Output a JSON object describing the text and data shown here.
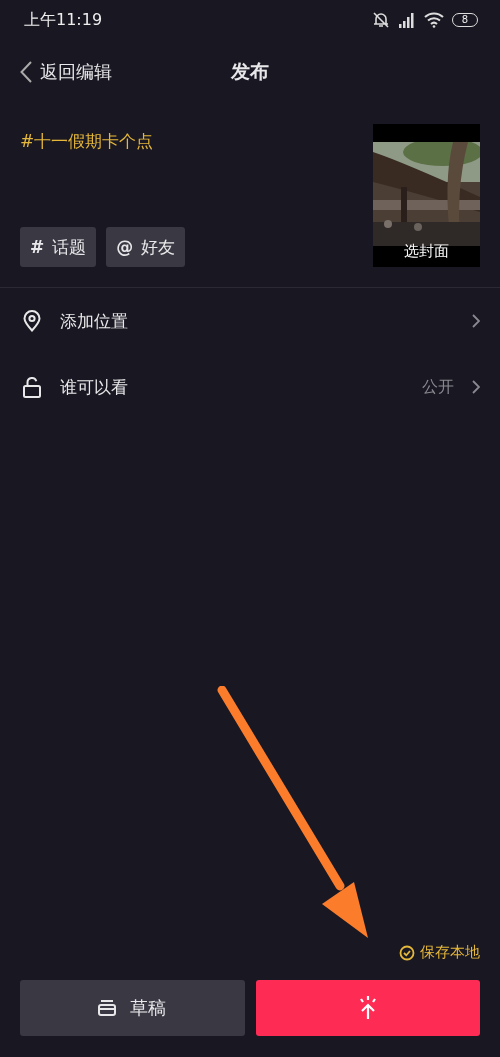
{
  "status_bar": {
    "time": "上午11:19",
    "battery": "8"
  },
  "nav": {
    "back_label": "返回编辑",
    "title": "发布"
  },
  "caption": "#十一假期卡个点",
  "tag_buttons": [
    {
      "label": "话题",
      "icon": "#"
    },
    {
      "label": "好友",
      "icon": "@"
    }
  ],
  "cover": {
    "label": "选封面"
  },
  "settings": [
    {
      "kind": "location",
      "label": "添加位置"
    },
    {
      "kind": "visibility",
      "label": "谁可以看",
      "value": "公开"
    }
  ],
  "save_local": {
    "label": "保存本地",
    "checked": true
  },
  "buttons": [
    {
      "kind": "draft",
      "label": "草稿"
    },
    {
      "kind": "publish"
    }
  ]
}
